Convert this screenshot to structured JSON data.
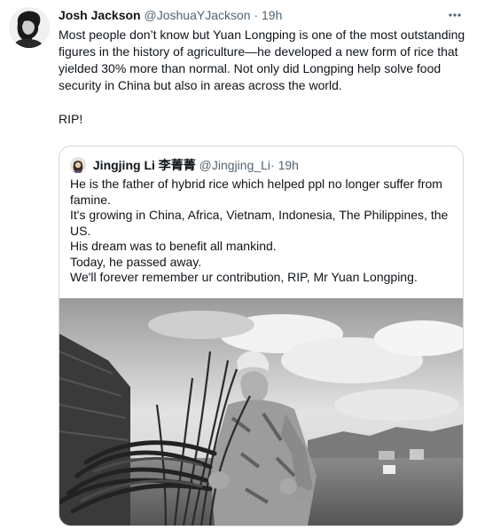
{
  "tweet": {
    "author": {
      "display_name": "Josh Jackson",
      "handle": "@JoshuaYJackson",
      "separator": "·",
      "time": "19h"
    },
    "more_icon": "more-horizontal-icon",
    "text_paragraphs": [
      "Most people don’t know but Yuan Longping is one of the most outstanding figures in the history of agriculture—he developed a new form of rice that yielded 30% more than normal. Not only did Longping help solve food security in China but also in areas across the world."
    ],
    "closing_text": "RIP!"
  },
  "quote": {
    "author": {
      "display_name": "Jingjing Li 李菁菁",
      "handle": "@Jingjing_Li",
      "separator": "·",
      "time": "19h"
    },
    "lines": [
      "He is the father of hybrid rice which helped ppl no longer suffer from famine.",
      "It's growing in China, Africa, Vietnam, Indonesia, The Philippines, the US.",
      "His dream was to benefit all mankind.",
      "Today, he passed away.",
      "We'll forever remember ur contribution, RIP, Mr Yuan Longping."
    ],
    "photo_colors": {
      "sky": "#d9d9d9",
      "ground": "#6f6f6f"
    }
  }
}
